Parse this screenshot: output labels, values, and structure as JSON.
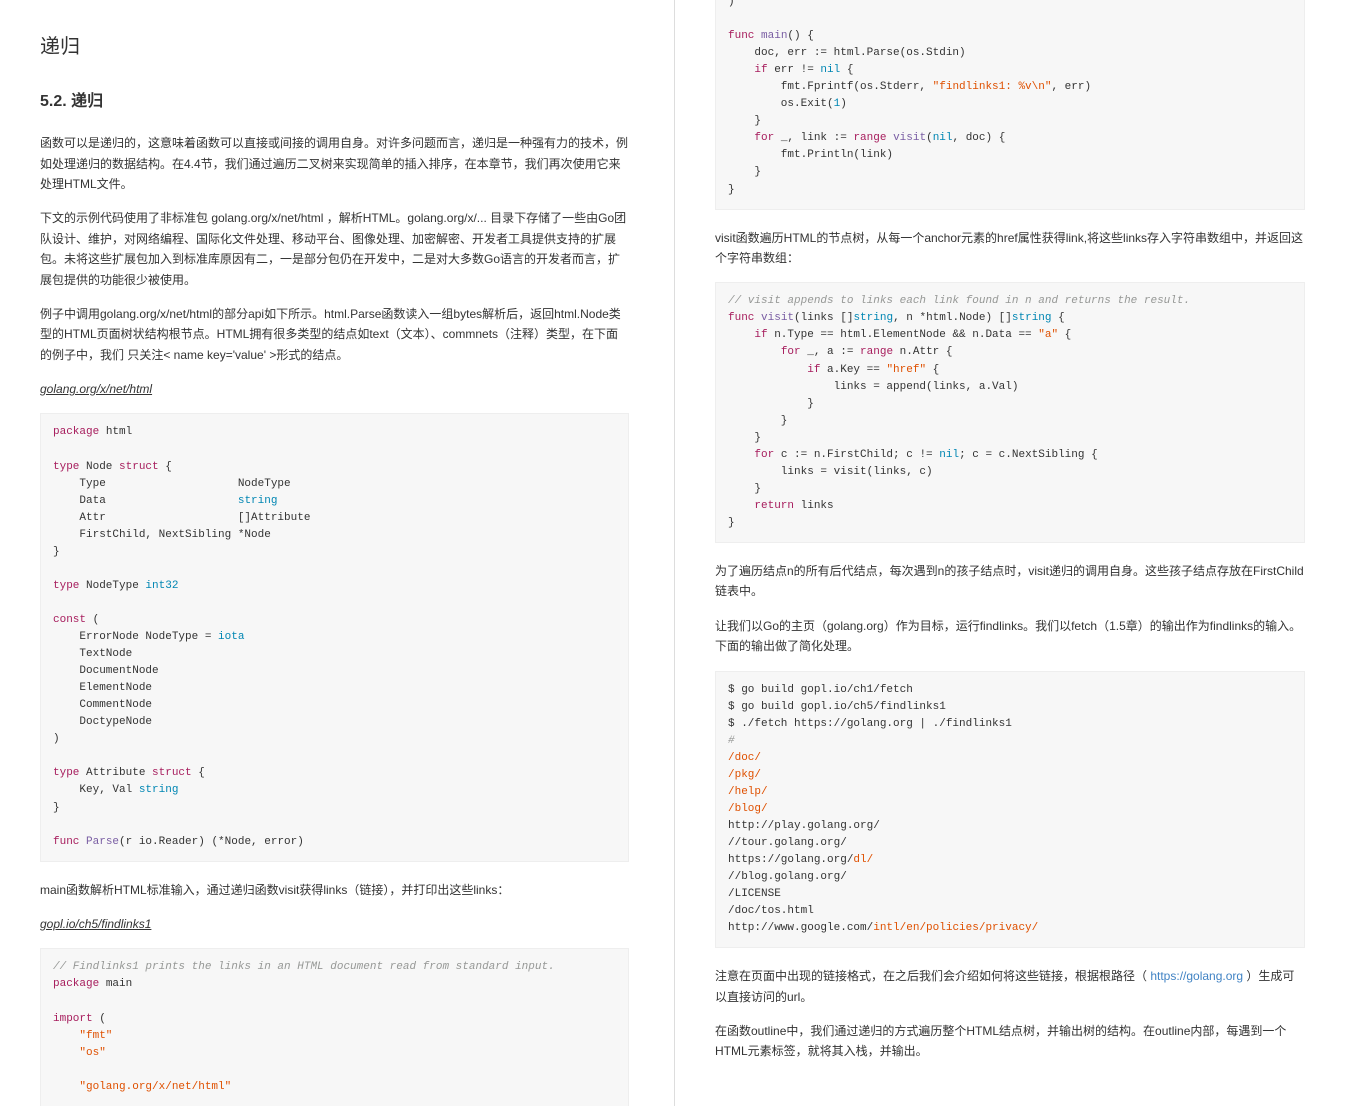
{
  "title": "递归",
  "section": "5.2. 递归",
  "para1": "函数可以是递归的，这意味着函数可以直接或间接的调用自身。对许多问题而言，递归是一种强有力的技术，例如处理递归的数据结构。在4.4节，我们通过遍历二叉树来实现简单的插入排序，在本章节，我们再次使用它来处理HTML文件。",
  "para2": "下文的示例代码使用了非标准包 golang.org/x/net/html ，解析HTML。golang.org/x/... 目录下存储了一些由Go团队设计、维护，对网络编程、国际化文件处理、移动平台、图像处理、加密解密、开发者工具提供支持的扩展包。未将这些扩展包加入到标准库原因有二，一是部分包仍在开发中，二是对大多数Go语言的开发者而言，扩展包提供的功能很少被使用。",
  "para3": "例子中调用golang.org/x/net/html的部分api如下所示。html.Parse函数读入一组bytes解析后，返回html.Node类型的HTML页面树状结构根节点。HTML拥有很多类型的结点如text（文本）、commnets（注释）类型，在下面的例子中，我们 只关注< name key='value' >形式的结点。",
  "link1": "golang.org/x/net/html",
  "link2": "gopl.io/ch5/findlinks1",
  "mainDesc": "main函数解析HTML标准输入，通过递归函数visit获得links（链接），并打印出这些links：",
  "r_para1": "visit函数遍历HTML的节点树，从每一个anchor元素的href属性获得link,将这些links存入字符串数组中，并返回这个字符串数组：",
  "r_para2": "为了遍历结点n的所有后代结点，每次遇到n的孩子结点时，visit递归的调用自身。这些孩子结点存放在FirstChild链表中。",
  "r_para3_a": "让我们以Go的主页（golang.org）作为目标，运行findlinks。我们以fetch（1.5章）的输出作为findlinks的输入。下面的输出做了简化处理。",
  "r_para4_a": "注意在页面中出现的链接格式，在之后我们会介绍如何将这些链接，根据根路径（ ",
  "r_para4_link": "https://golang.org",
  "r_para4_b": " ）生成可以直接访问的url。",
  "r_para5": "在函数outline中，我们通过递归的方式遍历整个HTML结点树，并输出树的结构。在outline内部，每遇到一个HTML元素标签，就将其入栈，并输出。",
  "code1_lines": [
    {
      "t": "plain",
      "v": "package html"
    },
    {
      "t": "plain",
      "v": ""
    },
    {
      "t": "plain",
      "v": "type Node struct {"
    },
    {
      "t": "plain",
      "v": "    Type                    NodeType"
    },
    {
      "t": "plain",
      "v": "    Data                    string",
      "cls": "hasType",
      "typeWord": "string",
      "prefix": "    Data                    "
    },
    {
      "t": "plain",
      "v": "    Attr                    []Attribute"
    },
    {
      "t": "plain",
      "v": "    FirstChild, NextSibling *Node"
    },
    {
      "t": "plain",
      "v": "}"
    },
    {
      "t": "plain",
      "v": ""
    },
    {
      "t": "plain",
      "v": "type NodeType int32"
    },
    {
      "t": "plain",
      "v": ""
    },
    {
      "t": "kw",
      "v": "const ("
    },
    {
      "t": "plain",
      "v": "    ErrorNode NodeType = iota"
    },
    {
      "t": "plain",
      "v": "    TextNode"
    },
    {
      "t": "plain",
      "v": "    DocumentNode"
    },
    {
      "t": "plain",
      "v": "    ElementNode"
    },
    {
      "t": "plain",
      "v": "    CommentNode"
    },
    {
      "t": "plain",
      "v": "    DoctypeNode"
    },
    {
      "t": "plain",
      "v": ")"
    },
    {
      "t": "plain",
      "v": ""
    },
    {
      "t": "plain",
      "v": "type Attribute struct {"
    },
    {
      "t": "plain",
      "v": "    Key, Val string",
      "cls": "hasType",
      "typeWord": "string",
      "prefix": "    Key, Val "
    },
    {
      "t": "plain",
      "v": "}"
    },
    {
      "t": "plain",
      "v": ""
    },
    {
      "t": "parse",
      "v": "func Parse(r io.Reader) (*Node, error)"
    }
  ],
  "code2_lines": [
    {
      "html": "<span class='cmt'>// Findlinks1 prints the links in an HTML document read from standard input.</span>"
    },
    {
      "html": "<span class='kw'>package</span> main"
    },
    {
      "html": ""
    },
    {
      "html": "<span class='kw'>import</span> ("
    },
    {
      "html": "    <span class='str'>\"fmt\"</span>"
    },
    {
      "html": "    <span class='str'>\"os\"</span>"
    },
    {
      "html": ""
    },
    {
      "html": "    <span class='str'>\"golang.org/x/net/html\"</span>"
    }
  ],
  "code3_lines": [
    {
      "html": ")"
    },
    {
      "html": ""
    },
    {
      "html": "<span class='kw'>func</span> <span class='fn'>main</span>() {"
    },
    {
      "html": "    doc, err := html.Parse(os.Stdin)"
    },
    {
      "html": "    <span class='kw'>if</span> err != <span class='typ'>nil</span> {"
    },
    {
      "html": "        fmt.Fprintf(os.Stderr, <span class='str'>\"findlinks1: %v\\n\"</span>, err)"
    },
    {
      "html": "        os.Exit(<span class='num'>1</span>)"
    },
    {
      "html": "    }"
    },
    {
      "html": "    <span class='kw'>for</span> _, link := <span class='kw'>range</span> <span class='fn'>visit</span>(<span class='typ'>nil</span>, doc) {"
    },
    {
      "html": "        fmt.Println(link)"
    },
    {
      "html": "    }"
    },
    {
      "html": "}"
    }
  ],
  "code4_lines": [
    {
      "html": "<span class='cmt'>// visit appends to links each link found in n and returns the result.</span>"
    },
    {
      "html": "<span class='kw'>func</span> <span class='fn'>visit</span>(links []<span class='typ'>string</span>, n *html.Node) []<span class='typ'>string</span> {"
    },
    {
      "html": "    <span class='kw'>if</span> n.Type == html.ElementNode &amp;&amp; n.Data == <span class='str'>\"a\"</span> {"
    },
    {
      "html": "        <span class='kw'>for</span> _, a := <span class='kw'>range</span> n.Attr {"
    },
    {
      "html": "            <span class='kw'>if</span> a.Key == <span class='str'>\"href\"</span> {"
    },
    {
      "html": "                links = append(links, a.Val)"
    },
    {
      "html": "            }"
    },
    {
      "html": "        }"
    },
    {
      "html": "    }"
    },
    {
      "html": "    <span class='kw'>for</span> c := n.FirstChild; c != <span class='typ'>nil</span>; c = c.NextSibling {"
    },
    {
      "html": "        links = visit(links, c)"
    },
    {
      "html": "    }"
    },
    {
      "html": "    <span class='kw'>return</span> links"
    },
    {
      "html": "}"
    }
  ],
  "code5_lines": [
    {
      "html": "$ go build gopl.io/ch1/fetch"
    },
    {
      "html": "$ go build gopl.io/ch5/findlinks1"
    },
    {
      "html": "$ ./fetch https://golang.org | ./findlinks1"
    },
    {
      "html": "<span class='cmt'>#</span>"
    },
    {
      "html": "<span class='str'>/doc/</span>"
    },
    {
      "html": "<span class='str'>/pkg/</span>"
    },
    {
      "html": "<span class='str'>/help/</span>"
    },
    {
      "html": "<span class='str'>/blog/</span>"
    },
    {
      "html": "http://play.golang.org/"
    },
    {
      "html": "//tour.golang.org/"
    },
    {
      "html": "https://golang.org/<span class='str'>dl/</span>"
    },
    {
      "html": "//blog.golang.org/"
    },
    {
      "html": "/LICENSE"
    },
    {
      "html": "/doc/tos.html"
    },
    {
      "html": "http://www.google.com/<span class='str'>intl/en/policies/privacy/</span>"
    }
  ]
}
